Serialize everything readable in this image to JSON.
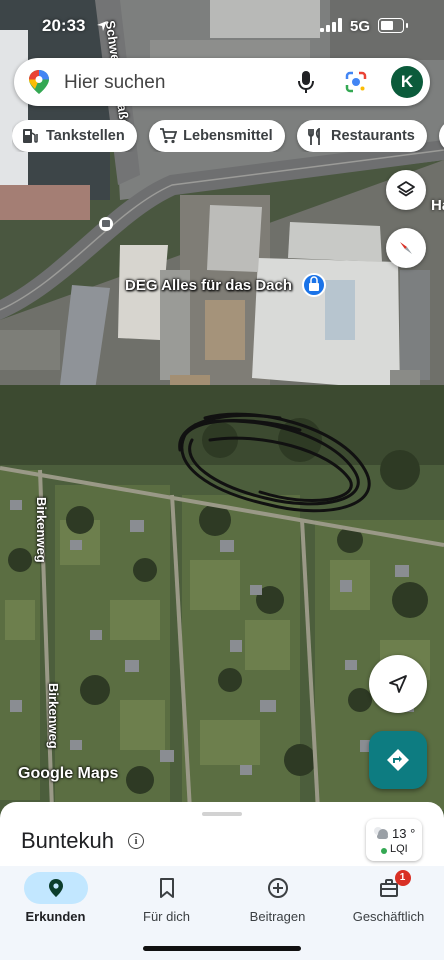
{
  "status_bar": {
    "time": "20:33",
    "network": "5G",
    "battery_level_percent": 60
  },
  "search": {
    "placeholder": "Hier suchen",
    "avatar_initial": "K"
  },
  "chips": [
    {
      "label": "Tankstellen",
      "icon": "fuel-pump-icon"
    },
    {
      "label": "Lebensmittel",
      "icon": "shopping-cart-icon"
    },
    {
      "label": "Restaurants",
      "icon": "fork-knife-icon"
    },
    {
      "label": "",
      "icon": "hotel-icon"
    }
  ],
  "map": {
    "business_label": "DEG Alles für das Dach",
    "street_top": "Schwerter Straße",
    "street_left_1": "Birkenweg",
    "street_left_2": "Birkenweg",
    "edge_letter": "Ha",
    "attribution": "Google Maps",
    "colors": {
      "directions_button": "#0d7c81",
      "pin_business": "#1a73e8"
    }
  },
  "sheet": {
    "place_name": "Buntekuh",
    "info_glyph": "i",
    "weather": {
      "temperature": "13 °",
      "air_quality": "LQI",
      "icon": "partly-cloudy-icon"
    }
  },
  "nav": {
    "items": [
      {
        "label": "Erkunden",
        "icon": "location-pin-icon",
        "active": true
      },
      {
        "label": "Für dich",
        "icon": "bookmark-icon",
        "active": false
      },
      {
        "label": "Beitragen",
        "icon": "plus-circle-icon",
        "active": false
      },
      {
        "label": "Geschäftlich",
        "icon": "store-icon",
        "active": false,
        "badge": "1"
      }
    ]
  }
}
